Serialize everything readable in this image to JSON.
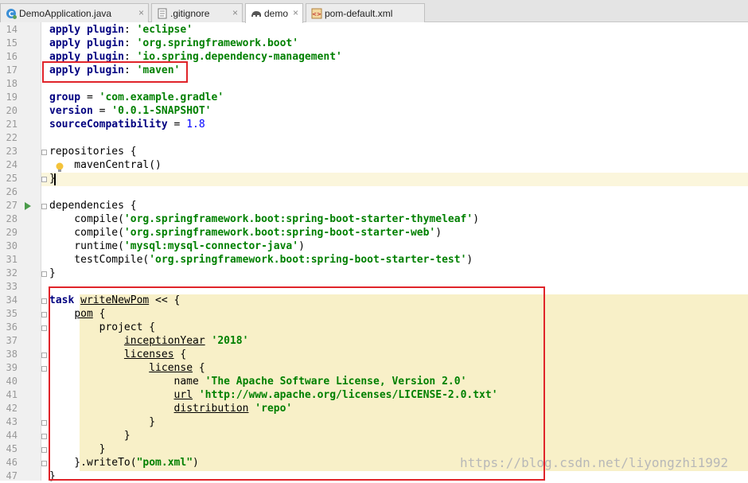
{
  "tabs": [
    {
      "label": "DemoApplication.java",
      "icon": "java-class-icon",
      "closable": true,
      "active": false
    },
    {
      "label": ".gitignore",
      "icon": "text-file-icon",
      "closable": true,
      "active": false
    },
    {
      "label": "demo",
      "icon": "gradle-elephant-icon",
      "closable": true,
      "active": true
    },
    {
      "label": "pom-default.xml",
      "icon": "xml-file-icon",
      "closable": false,
      "active": false
    }
  ],
  "close_glyph": "×",
  "colors": {
    "keyword": "#000080",
    "string": "#008000",
    "number": "#0000ff",
    "highlight_box": "#e0242a",
    "caret_row": "#fbf6dc",
    "task_block": "#f8f0c8"
  },
  "editor": {
    "language": "groovy (build.gradle)",
    "lines": [
      {
        "n": "14",
        "text": "apply plugin: 'eclipse'"
      },
      {
        "n": "15",
        "text": "apply plugin: 'org.springframework.boot'"
      },
      {
        "n": "16",
        "text": "apply plugin: 'io.spring.dependency-management'"
      },
      {
        "n": "17",
        "text": "apply plugin: 'maven'"
      },
      {
        "n": "18",
        "text": ""
      },
      {
        "n": "19",
        "text": "group = 'com.example.gradle'"
      },
      {
        "n": "20",
        "text": "version = '0.0.1-SNAPSHOT'"
      },
      {
        "n": "21",
        "text": "sourceCompatibility = 1.8"
      },
      {
        "n": "22",
        "text": ""
      },
      {
        "n": "23",
        "text": "repositories {"
      },
      {
        "n": "24",
        "text": "    mavenCentral()"
      },
      {
        "n": "25",
        "text": "}"
      },
      {
        "n": "26",
        "text": ""
      },
      {
        "n": "27",
        "text": "dependencies {"
      },
      {
        "n": "28",
        "text": "    compile('org.springframework.boot:spring-boot-starter-thymeleaf')"
      },
      {
        "n": "29",
        "text": "    compile('org.springframework.boot:spring-boot-starter-web')"
      },
      {
        "n": "30",
        "text": "    runtime('mysql:mysql-connector-java')"
      },
      {
        "n": "31",
        "text": "    testCompile('org.springframework.boot:spring-boot-starter-test')"
      },
      {
        "n": "32",
        "text": "}"
      },
      {
        "n": "33",
        "text": ""
      },
      {
        "n": "34",
        "text": "task writeNewPom << {"
      },
      {
        "n": "35",
        "text": "    pom {"
      },
      {
        "n": "36",
        "text": "        project {"
      },
      {
        "n": "37",
        "text": "            inceptionYear '2018'"
      },
      {
        "n": "38",
        "text": "            licenses {"
      },
      {
        "n": "39",
        "text": "                license {"
      },
      {
        "n": "40",
        "text": "                    name 'The Apache Software License, Version 2.0'"
      },
      {
        "n": "41",
        "text": "                    url 'http://www.apache.org/licenses/LICENSE-2.0.txt'"
      },
      {
        "n": "42",
        "text": "                    distribution 'repo'"
      },
      {
        "n": "43",
        "text": "                }"
      },
      {
        "n": "44",
        "text": "            }"
      },
      {
        "n": "45",
        "text": "        }"
      },
      {
        "n": "46",
        "text": "    }.writeTo(\"pom.xml\")"
      },
      {
        "n": "47",
        "text": "}"
      }
    ]
  },
  "gutter_icons": {
    "run": "run-gradle-icon",
    "intention": "lightbulb-icon"
  },
  "watermark": "https://blog.csdn.net/liyongzhi1992"
}
